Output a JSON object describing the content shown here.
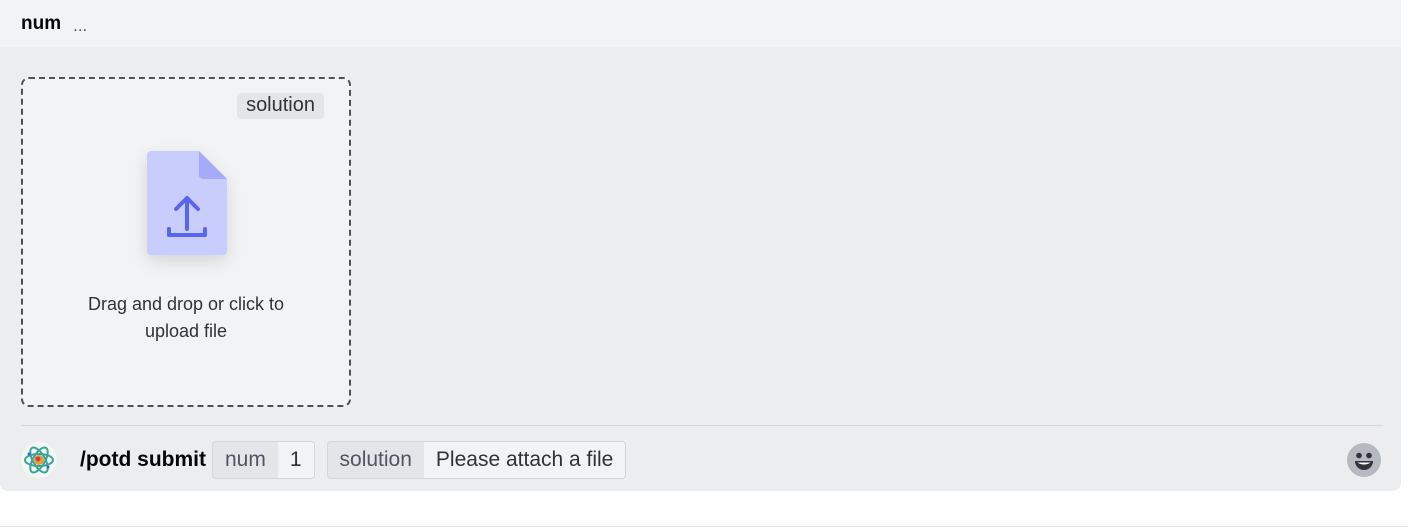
{
  "header": {
    "title": "num",
    "ellipsis": "..."
  },
  "dropzone": {
    "tag": "solution",
    "line1": "Drag and drop or click to",
    "line2": "upload file",
    "icon": "file-upload-icon"
  },
  "command": {
    "name": "/potd submit",
    "options": [
      {
        "name": "num",
        "value": "1"
      },
      {
        "name": "solution",
        "value": "Please attach a file"
      }
    ]
  },
  "icons": {
    "avatar": "bot-avatar",
    "emoji": "emoji-smile-icon"
  },
  "colors": {
    "accent": "#5865f2",
    "file_body": "#c9cdfb",
    "file_fold": "#a5abf6",
    "panel": "#ebedef"
  }
}
